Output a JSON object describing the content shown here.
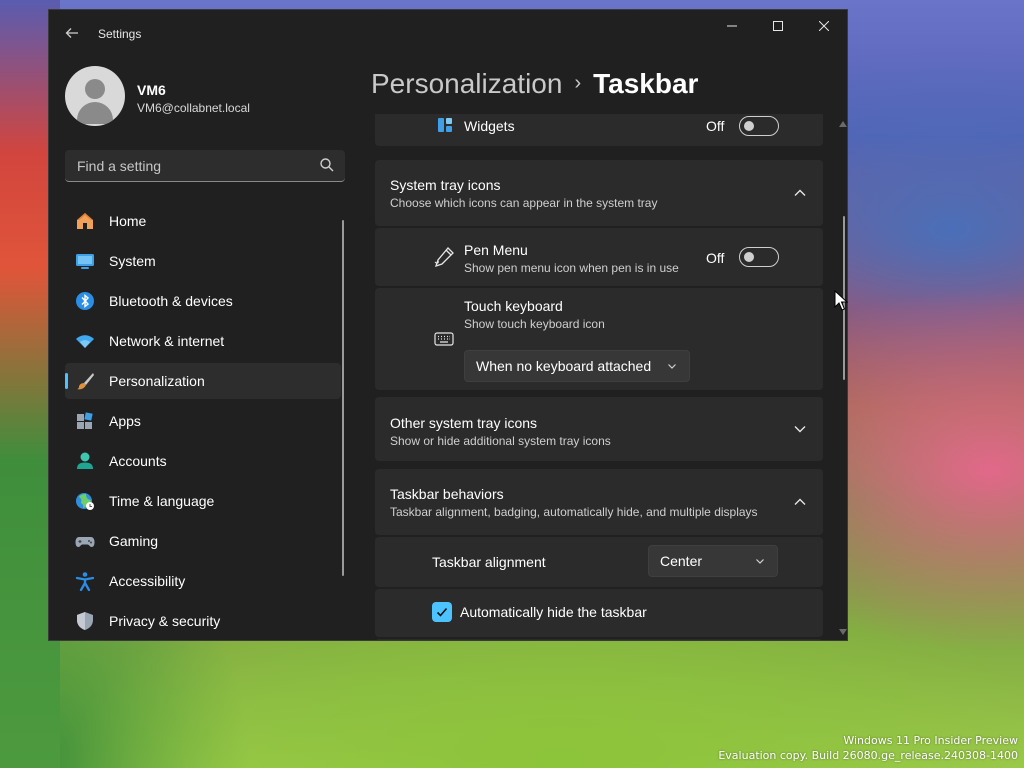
{
  "window": {
    "title": "Settings"
  },
  "user": {
    "name": "VM6",
    "email": "VM6@collabnet.local"
  },
  "search": {
    "placeholder": "Find a setting"
  },
  "nav": {
    "items": [
      {
        "label": "Home",
        "icon": "home-icon"
      },
      {
        "label": "System",
        "icon": "system-icon"
      },
      {
        "label": "Bluetooth & devices",
        "icon": "bluetooth-icon"
      },
      {
        "label": "Network & internet",
        "icon": "wifi-icon"
      },
      {
        "label": "Personalization",
        "icon": "brush-icon",
        "active": true
      },
      {
        "label": "Apps",
        "icon": "apps-icon"
      },
      {
        "label": "Accounts",
        "icon": "accounts-icon"
      },
      {
        "label": "Time & language",
        "icon": "globe-icon"
      },
      {
        "label": "Gaming",
        "icon": "gamepad-icon"
      },
      {
        "label": "Accessibility",
        "icon": "accessibility-icon"
      },
      {
        "label": "Privacy & security",
        "icon": "shield-icon"
      }
    ]
  },
  "breadcrumb": {
    "parent": "Personalization",
    "separator": "›",
    "current": "Taskbar"
  },
  "content": {
    "widgets": {
      "label": "Widgets",
      "state": "Off"
    },
    "system_tray": {
      "title": "System tray icons",
      "subtitle": "Choose which icons can appear in the system tray",
      "pen_menu": {
        "title": "Pen Menu",
        "subtitle": "Show pen menu icon when pen is in use",
        "state": "Off"
      },
      "touch_keyboard": {
        "title": "Touch keyboard",
        "subtitle": "Show touch keyboard icon",
        "dropdown": "When no keyboard attached"
      }
    },
    "other_tray": {
      "title": "Other system tray icons",
      "subtitle": "Show or hide additional system tray icons"
    },
    "behaviors": {
      "title": "Taskbar behaviors",
      "subtitle": "Taskbar alignment, badging, automatically hide, and multiple displays",
      "alignment": {
        "label": "Taskbar alignment",
        "value": "Center"
      },
      "auto_hide": {
        "label": "Automatically hide the taskbar",
        "checked": true
      }
    }
  },
  "watermark": {
    "line1": "Windows 11 Pro Insider Preview",
    "line2": "Evaluation copy. Build 26080.ge_release.240308-1400"
  },
  "colors": {
    "accent": "#4cc2ff",
    "window_bg": "#202020",
    "card_bg": "#2b2b2b"
  }
}
